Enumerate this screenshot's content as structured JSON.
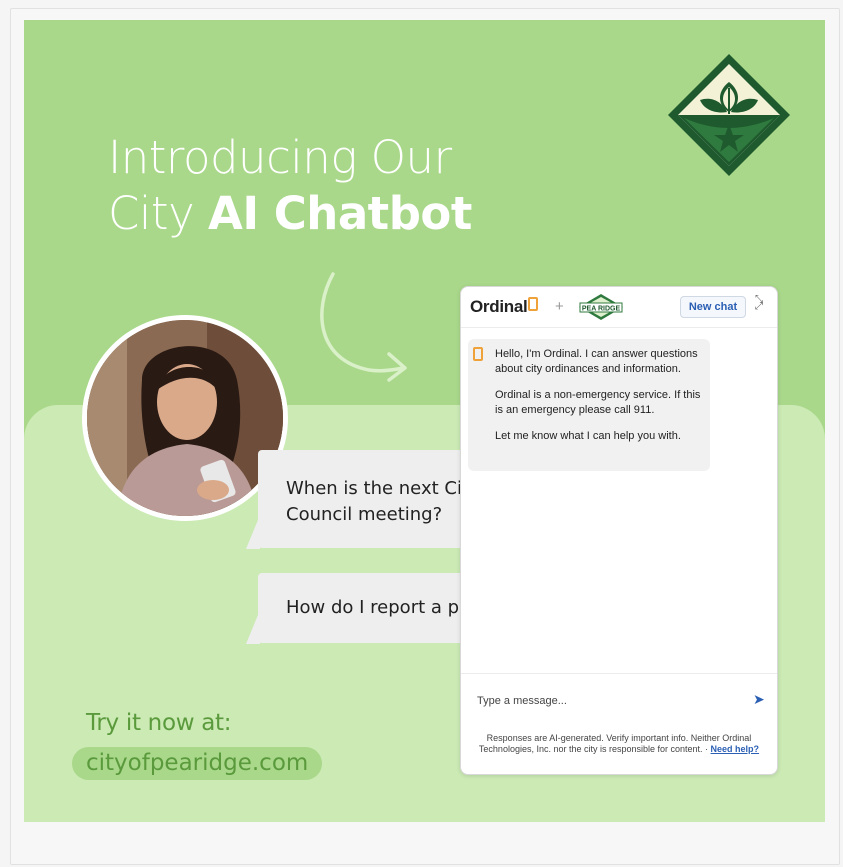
{
  "headline": {
    "line1": "Introducing Our",
    "line2_plain": "City ",
    "line2_bold": "AI Chatbot"
  },
  "conversation": {
    "question1": "When is the next City Council meeting?",
    "question2": "How do I report a pothole?"
  },
  "cta": {
    "label": "Try it now at:",
    "url": "cityofpearidge.com"
  },
  "chat_widget": {
    "brand": "Ordinal",
    "plus": "+",
    "partner_logo_text": "PEA RIDGE",
    "new_chat_label": "New chat",
    "bot_message": {
      "p1": "Hello, I'm Ordinal. I can answer questions about city ordinances and information.",
      "p2": "Ordinal is a non-emergency service. If this is an emergency please call 911.",
      "p3": "Let me know what I can help you with."
    },
    "input_placeholder": "Type a message...",
    "disclaimer_text": "Responses are AI-generated. Verify important info. Neither Ordinal Technologies, Inc. nor the city is responsible for content. · ",
    "help_link": "Need help?"
  },
  "colors": {
    "poster_bg": "#a9d88a",
    "band_bg": "#cbeab4",
    "emblem_dark": "#1f5a2e",
    "accent_text": "#5a9a3c",
    "brand_orange": "#f0a23a",
    "link_blue": "#2b5fb4"
  },
  "icons": [
    "city-emblem-icon",
    "curved-arrow-icon",
    "send-icon",
    "expand-icon",
    "ordinal-logo-icon"
  ]
}
